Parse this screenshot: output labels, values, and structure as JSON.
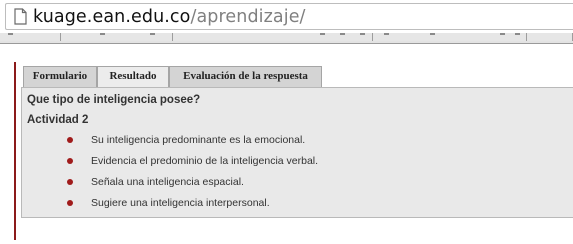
{
  "browser": {
    "url_host": "kuage.ean.edu.co",
    "url_path": "/aprendizaje/",
    "page_icon": "page-icon"
  },
  "tabs": [
    {
      "label": "Formulario",
      "active": false
    },
    {
      "label": "Resultado",
      "active": true
    },
    {
      "label": "Evaluación de la respuesta",
      "active": false
    }
  ],
  "content": {
    "question": "Que tipo de inteligencia posee?",
    "activity": "Actividad 2",
    "options": [
      "Su inteligencia predominante es la emocional.",
      "Evidencia el predominio de la inteligencia verbal.",
      "Señala una inteligencia espacial.",
      "Sugiere una inteligencia interpersonal."
    ]
  },
  "colors": {
    "accent_red": "#8b1a1a",
    "bullet": "#a01b1b",
    "panel_bg": "#e9e9e9",
    "tab_bg": "#d4d4d4",
    "tab_active_bg": "#ececec"
  }
}
